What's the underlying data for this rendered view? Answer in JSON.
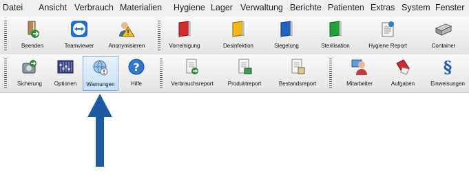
{
  "menubar": {
    "items": [
      "Datei",
      "Ansicht",
      "Verbrauch",
      "Materialien",
      "Hygiene",
      "Lager",
      "Verwaltung",
      "Berichte",
      "Patienten",
      "Extras",
      "System",
      "Fenster"
    ]
  },
  "toolbar1": {
    "buttons": [
      {
        "label": "Beenden",
        "icon": "exit-door-icon"
      },
      {
        "label": "Teamviewer",
        "icon": "teamviewer-icon"
      },
      {
        "label": "Anonymisieren",
        "icon": "anonymize-user-icon"
      },
      {
        "label": "Vorreinigung",
        "icon": "red-book-icon"
      },
      {
        "label": "Desinfektion",
        "icon": "yellow-book-icon"
      },
      {
        "label": "Siegelung",
        "icon": "blue-book-icon"
      },
      {
        "label": "Sterilisation",
        "icon": "green-book-icon"
      },
      {
        "label": "Hygiene Report",
        "icon": "report-icon"
      },
      {
        "label": "Container",
        "icon": "container-icon"
      }
    ]
  },
  "toolbar2": {
    "buttons": [
      {
        "label": "Sicherung",
        "icon": "backup-icon"
      },
      {
        "label": "Optionen",
        "icon": "options-icon"
      },
      {
        "label": "Warnungen",
        "icon": "warning-globe-icon",
        "selected": true
      },
      {
        "label": "Hilfe",
        "icon": "help-icon"
      },
      {
        "label": "Verbrauchsreport",
        "icon": "consumption-report-icon"
      },
      {
        "label": "Produktreport",
        "icon": "product-report-icon"
      },
      {
        "label": "Bestandsreport",
        "icon": "stock-report-icon"
      },
      {
        "label": "Mitarbeiter",
        "icon": "employee-icon"
      },
      {
        "label": "Aufgaben",
        "icon": "tasks-icon"
      },
      {
        "label": "Einweisungen",
        "icon": "paragraph-icon"
      }
    ]
  },
  "colors": {
    "arrow": "#1c5aa6",
    "selected_bg": "#c7dff7"
  }
}
